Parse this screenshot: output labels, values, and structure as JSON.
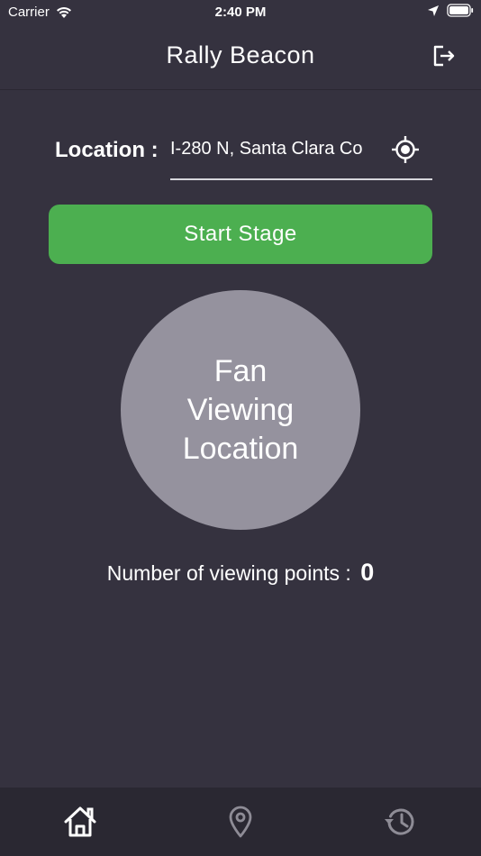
{
  "status_bar": {
    "carrier": "Carrier",
    "time": "2:40 PM"
  },
  "nav": {
    "title": "Rally Beacon",
    "logout_icon": "logout-icon"
  },
  "location": {
    "label": "Location :",
    "value": "I-280 N, Santa Clara Co",
    "locate_icon": "crosshair-icon"
  },
  "start_stage": {
    "label": "Start Stage",
    "color": "#4caf50"
  },
  "fan_viewing": {
    "lines": [
      "Fan",
      "Viewing",
      "Location"
    ],
    "color": "#95929e"
  },
  "viewing_points": {
    "label": "Number of viewing points :",
    "count": "0"
  },
  "tab_bar": {
    "tabs": [
      {
        "icon": "home-icon",
        "active": true
      },
      {
        "icon": "map-pin-icon",
        "active": false
      },
      {
        "icon": "history-icon",
        "active": false
      }
    ]
  },
  "colors": {
    "background": "#35323f",
    "tab_bar": "#2a2832",
    "icon_inactive": "#8e8c96"
  }
}
